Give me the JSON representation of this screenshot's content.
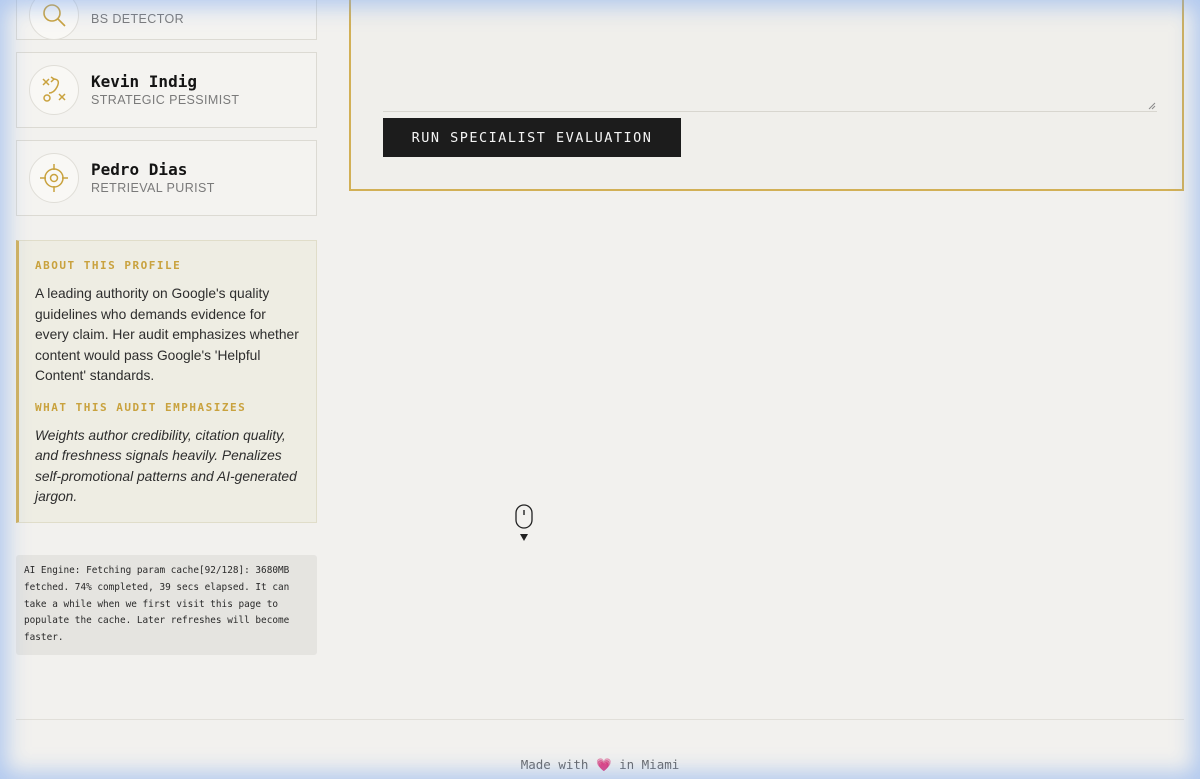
{
  "sidebar": {
    "profiles": [
      {
        "name": "",
        "role": "BS DETECTOR",
        "icon": "magnifier-icon"
      },
      {
        "name": "Kevin Indig",
        "role": "STRATEGIC PESSIMIST",
        "icon": "strategy-icon"
      },
      {
        "name": "Pedro Dias",
        "role": "RETRIEVAL PURIST",
        "icon": "crosshair-icon"
      }
    ],
    "about": {
      "heading": "ABOUT THIS PROFILE",
      "text": "A leading authority on Google's quality guidelines who demands evidence for every claim. Her audit emphasizes whether content would pass Google's 'Helpful Content' standards.",
      "emphasis_heading": "WHAT THIS AUDIT EMPHASIZES",
      "emphasis_text": "Weights author credibility, citation quality, and freshness signals heavily. Penalizes self-promotional patterns and AI-generated jargon."
    },
    "engine_status": "AI Engine: Fetching param cache[92/128]: 3680MB fetched. 74% completed, 39 secs elapsed. It can take a while when we first visit this page to populate the cache. Later refreshes will become faster."
  },
  "main": {
    "run_button_label": "RUN SPECIALIST EVALUATION"
  },
  "footer": {
    "prefix": "Made with",
    "heart": "💗",
    "suffix": "in Miami"
  },
  "colors": {
    "accent": "#d4b25a",
    "button_bg": "#1c1c1c",
    "background": "#f2f1ee"
  }
}
